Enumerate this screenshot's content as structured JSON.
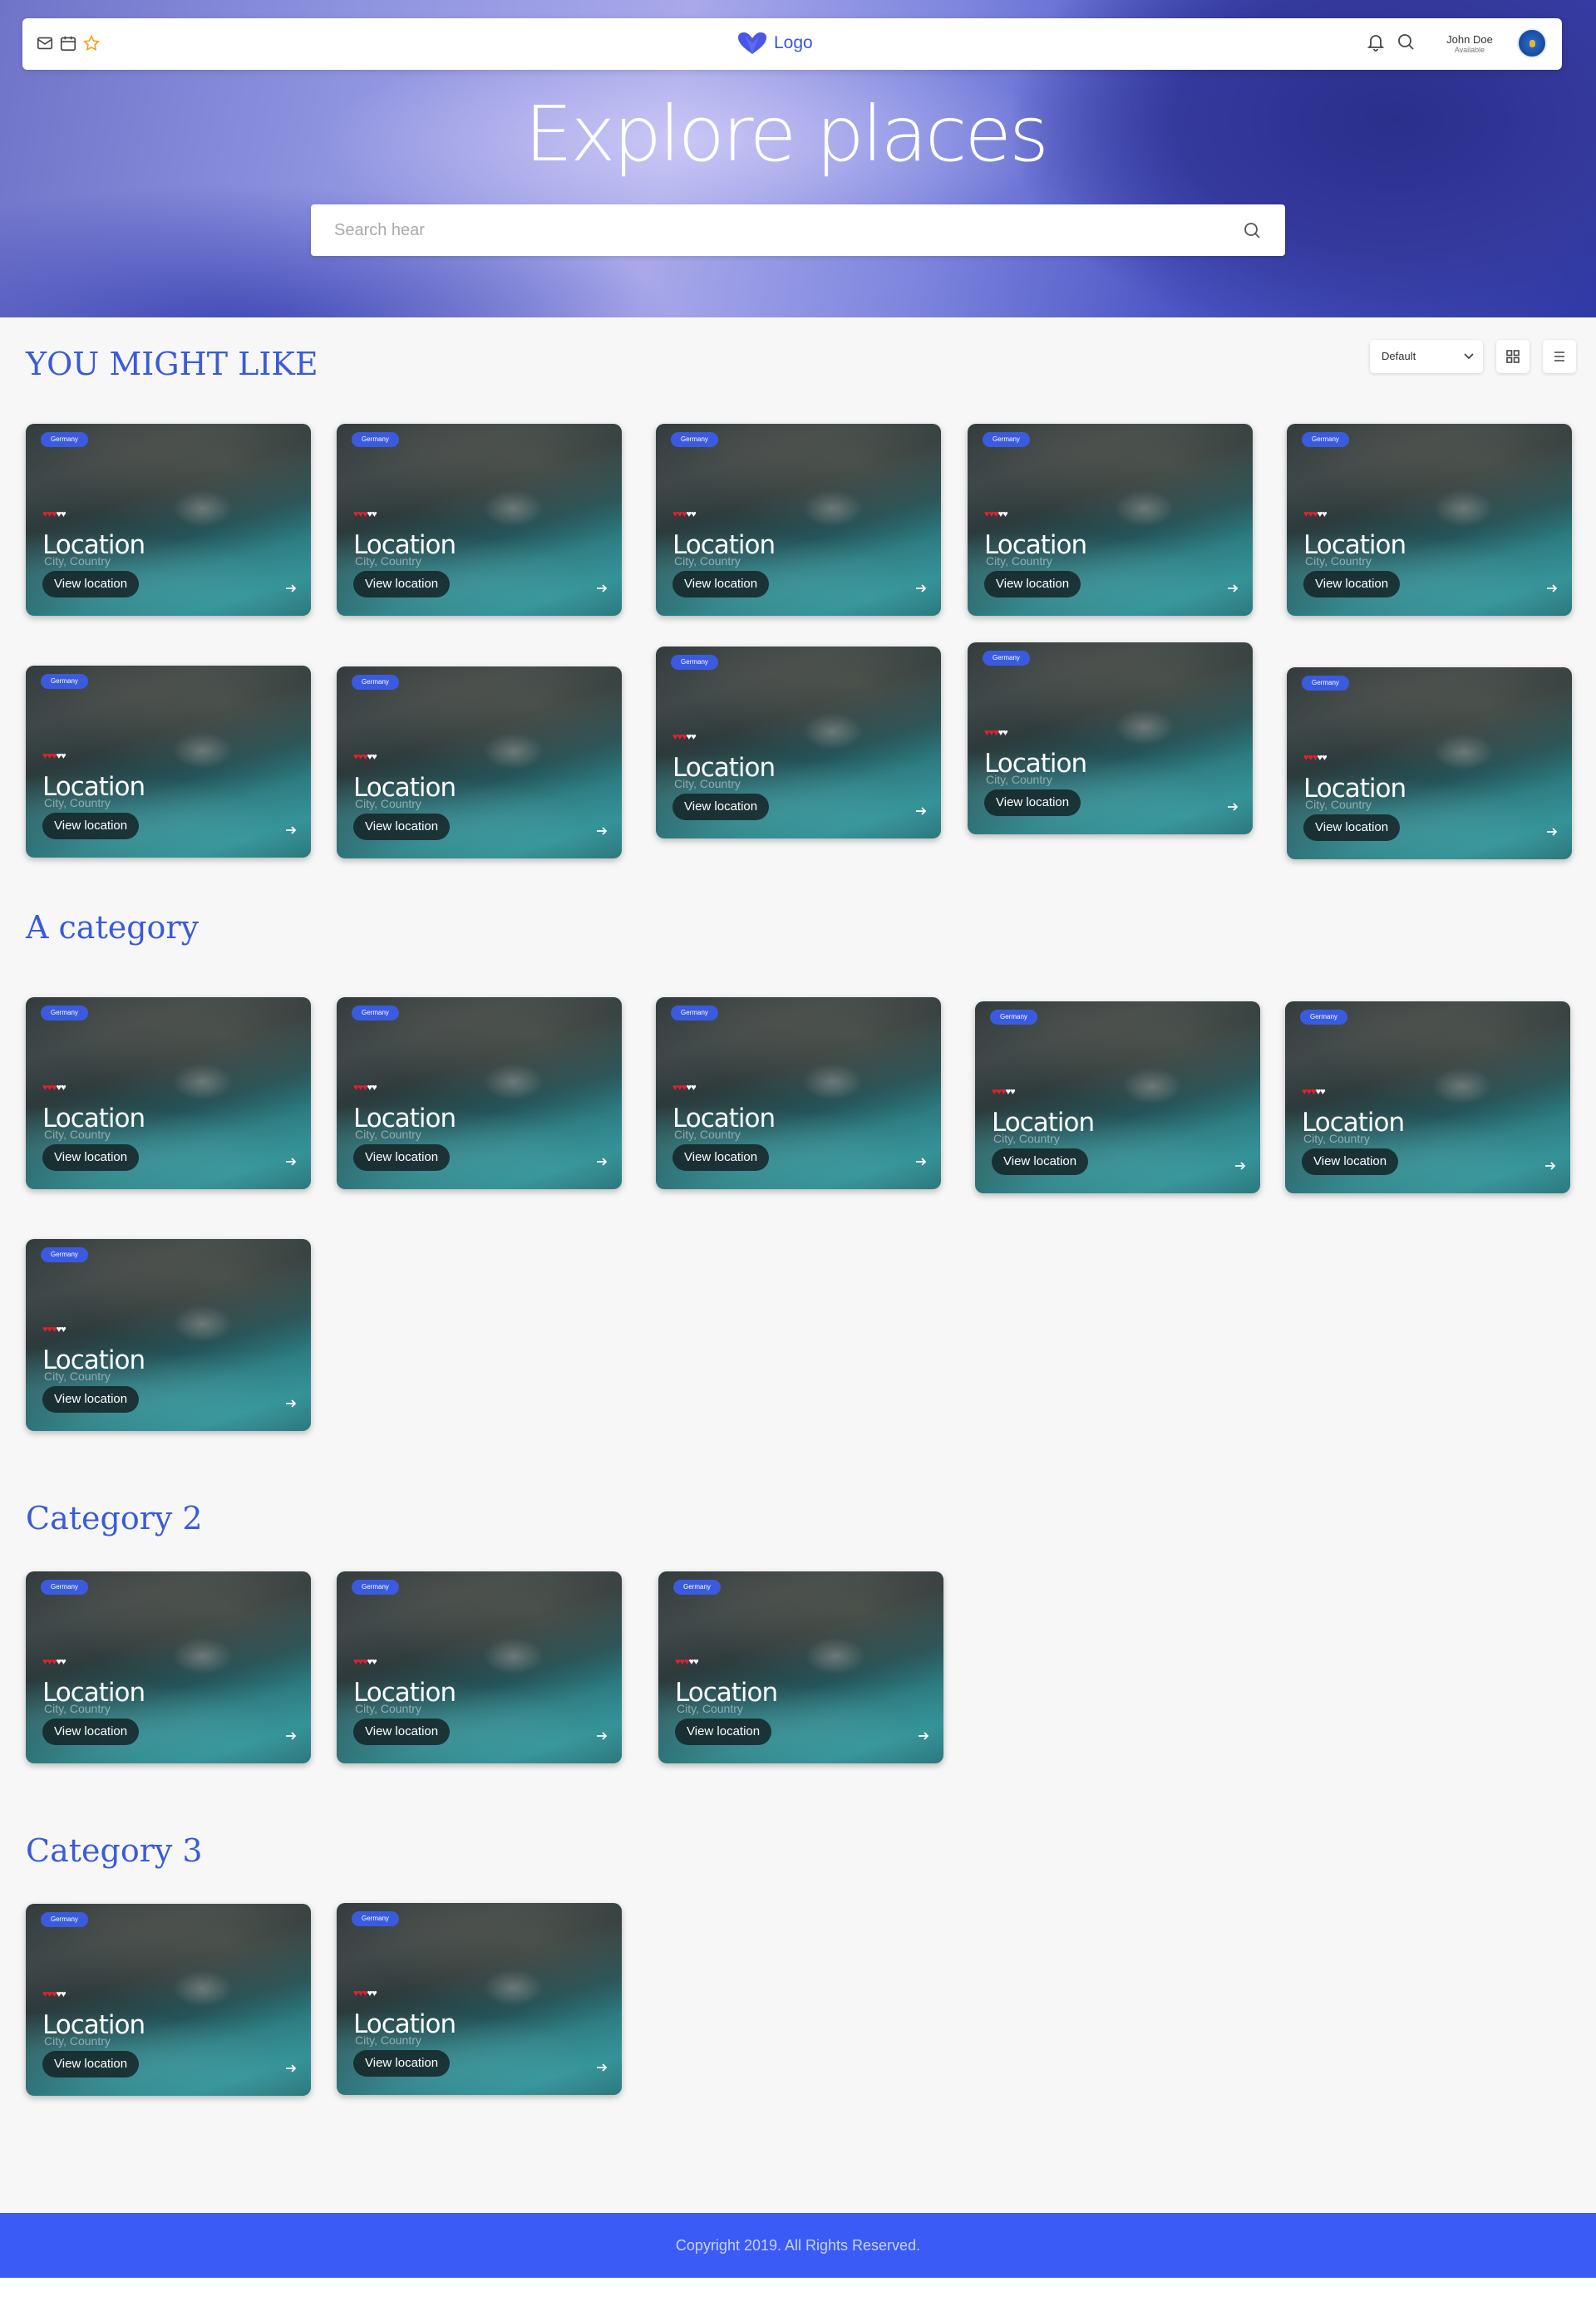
{
  "header": {
    "logo_text": "Logo",
    "user_name": "John Doe",
    "user_status": "Available",
    "left_icons": [
      "mail-icon",
      "calendar-icon",
      "star-icon"
    ],
    "right_icons": [
      "bell-icon",
      "search-icon"
    ]
  },
  "hero": {
    "title": "Explore places",
    "search_placeholder": "Search hear"
  },
  "controls": {
    "sort_selected": "Default"
  },
  "card": {
    "tag": "Germany",
    "title": "Location",
    "subtitle": "City, Country",
    "button": "View location",
    "rating_filled": 3,
    "rating_total": 5
  },
  "sections": [
    {
      "title": "YOU MIGHT LIKE",
      "count": 10
    },
    {
      "title": "A category",
      "count": 6
    },
    {
      "title": "Category 2",
      "count": 3
    },
    {
      "title": "Category 3",
      "count": 2
    }
  ],
  "footer": {
    "text": "Copyright 2019. All Rights Reserved."
  },
  "colors": {
    "accent": "#3a5bd9",
    "footer": "#3a5bf5",
    "heart": "#e4202e"
  }
}
